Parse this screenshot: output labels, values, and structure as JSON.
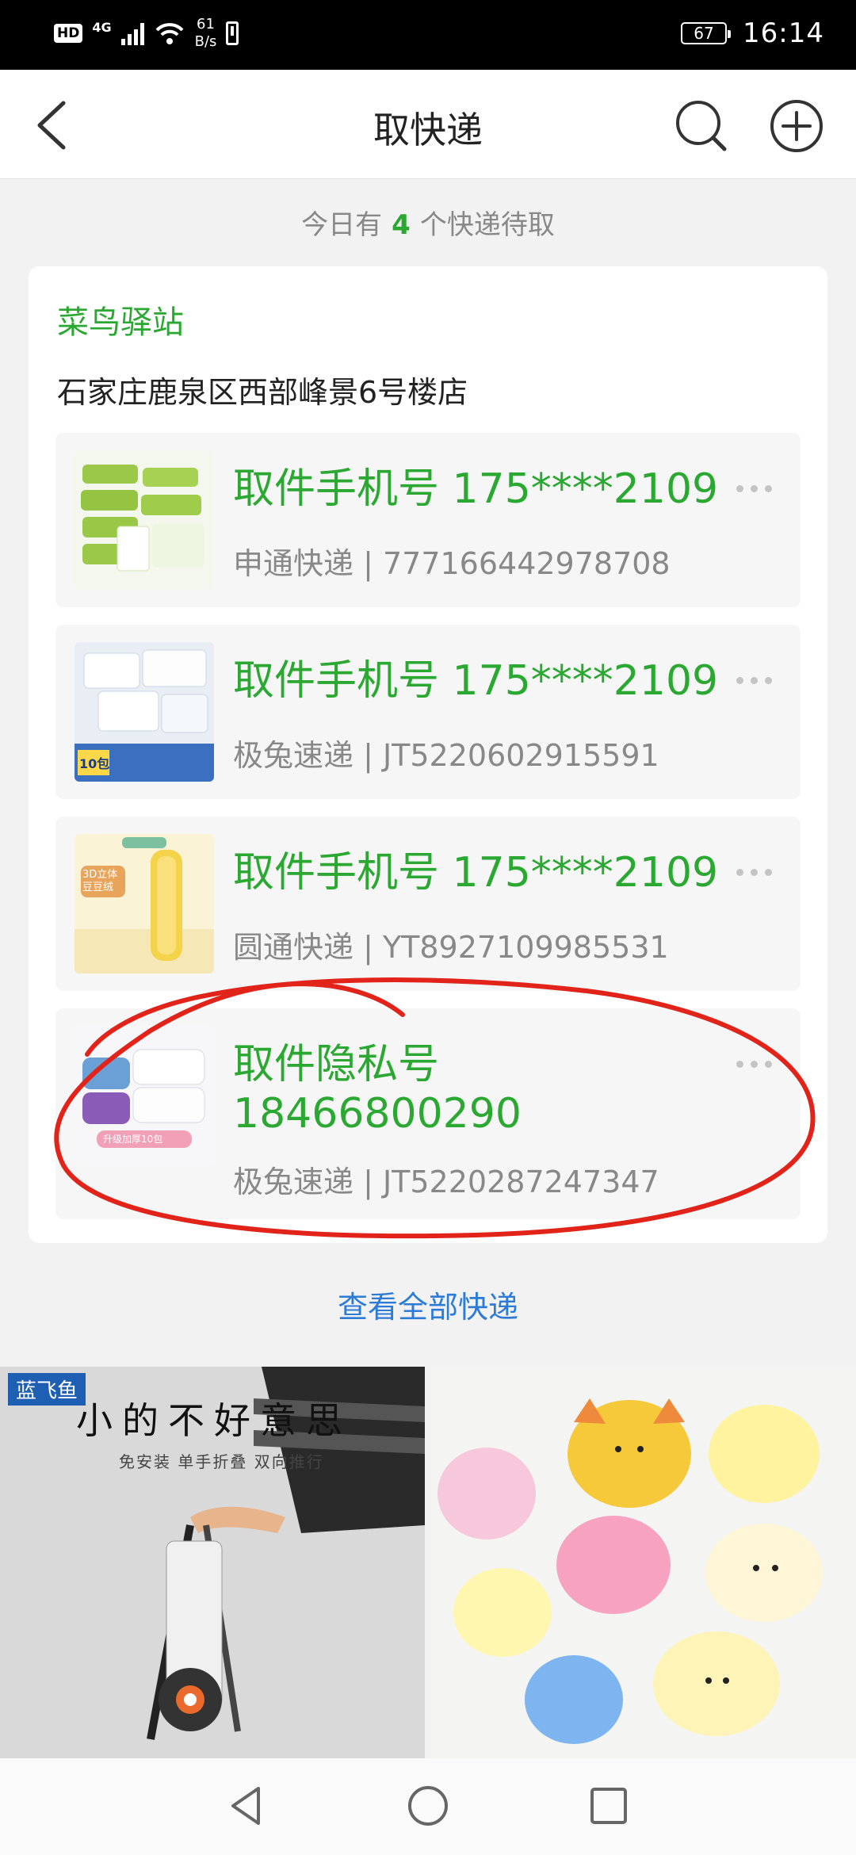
{
  "status_bar": {
    "hd": "HD",
    "network_type": "4G",
    "speed_value": "61",
    "speed_unit": "B/s",
    "battery": "67",
    "time": "16:14"
  },
  "nav": {
    "title": "取快递",
    "back_icon": "back-arrow-icon",
    "search_icon": "search-icon",
    "add_icon": "plus-icon"
  },
  "summary": {
    "prefix": "今日有",
    "count": "4",
    "suffix": "个快递待取"
  },
  "station": {
    "name": "菜鸟驿站",
    "address": "石家庄鹿泉区西部峰景6号楼店"
  },
  "packages": [
    {
      "code": "取件手机号 175****2109",
      "carrier": "申通快递 | 777166442978708"
    },
    {
      "code": "取件手机号 175****2109",
      "carrier": "极兔速递 | JT5220602915591"
    },
    {
      "code": "取件手机号 175****2109",
      "carrier": "圆通快递 | YT8927109985531"
    },
    {
      "code": "取件隐私号 18466800290",
      "carrier": "极兔速递 | JT5220287247347"
    }
  ],
  "thumb_texts": {
    "pkg2_badge": "10包",
    "pkg3_badge": "3D立体 豆豆绒",
    "pkg4_badge": "升级加厚10包"
  },
  "view_all": "查看全部快递",
  "promos": {
    "left_brand": "蓝飞鱼",
    "left_headline": "小的不好意思",
    "left_sub": "免安装 单手折叠 双向推行"
  },
  "colors": {
    "accent_green": "#2aa831",
    "link_blue": "#2c7bd6",
    "annotation_red": "#e2231a"
  }
}
